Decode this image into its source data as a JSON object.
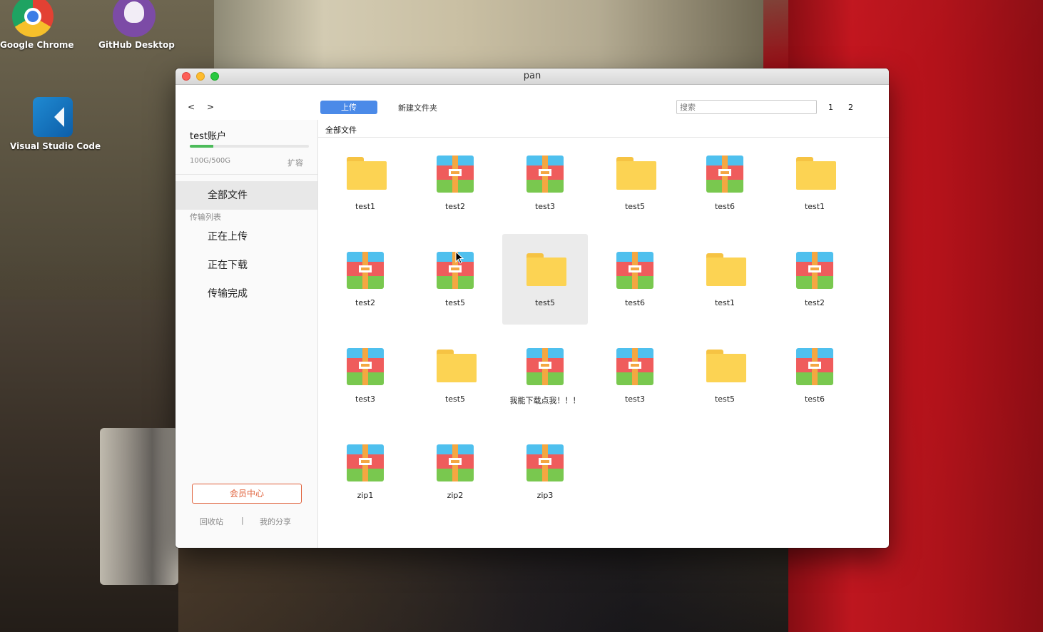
{
  "desktop": {
    "icons": [
      {
        "label": "Google Chrome",
        "icon": "chrome-icon"
      },
      {
        "label": "GitHub Desktop",
        "icon": "github-desktop-icon"
      },
      {
        "label": "Visual Studio Code",
        "icon": "vscode-icon"
      }
    ]
  },
  "window": {
    "title": "pan",
    "toolbar": {
      "back_label": "<",
      "forward_label": ">",
      "upload_label": "上传",
      "new_folder_label": "新建文件夹",
      "search_placeholder": "搜索",
      "pages": [
        "1",
        "2"
      ]
    },
    "sidebar": {
      "account_name": "test账户",
      "quota_text": "100G/500G",
      "quota_used_fraction": 0.2,
      "expand_label": "扩容",
      "all_files_label": "全部文件",
      "transfer_group_label": "传输列表",
      "items": [
        "正在上传",
        "正在下载",
        "传输完成"
      ],
      "vip_label": "会员中心",
      "recycle_label": "回收站",
      "divider": "|",
      "share_label": "我的分享"
    },
    "breadcrumb": "全部文件",
    "files": [
      {
        "name": "test1",
        "type": "folder"
      },
      {
        "name": "test2",
        "type": "zip"
      },
      {
        "name": "test3",
        "type": "zip"
      },
      {
        "name": "test5",
        "type": "folder"
      },
      {
        "name": "test6",
        "type": "zip"
      },
      {
        "name": "test1",
        "type": "folder"
      },
      {
        "name": "test2",
        "type": "zip"
      },
      {
        "name": "test5",
        "type": "zip"
      },
      {
        "name": "test5",
        "type": "folder",
        "selected": true
      },
      {
        "name": "test6",
        "type": "zip"
      },
      {
        "name": "test1",
        "type": "folder"
      },
      {
        "name": "test2",
        "type": "zip"
      },
      {
        "name": "test3",
        "type": "zip"
      },
      {
        "name": "test5",
        "type": "folder"
      },
      {
        "name": "我能下载点我！！！",
        "type": "zip"
      },
      {
        "name": "test3",
        "type": "zip"
      },
      {
        "name": "test5",
        "type": "folder"
      },
      {
        "name": "test6",
        "type": "zip"
      },
      {
        "name": "zip1",
        "type": "zip"
      },
      {
        "name": "zip2",
        "type": "zip"
      },
      {
        "name": "zip3",
        "type": "zip"
      }
    ]
  },
  "colors": {
    "accent": "#4b8ae8",
    "vip": "#e0603a",
    "quota_fill": "#4cbb5a",
    "folder": "#fcd353"
  }
}
